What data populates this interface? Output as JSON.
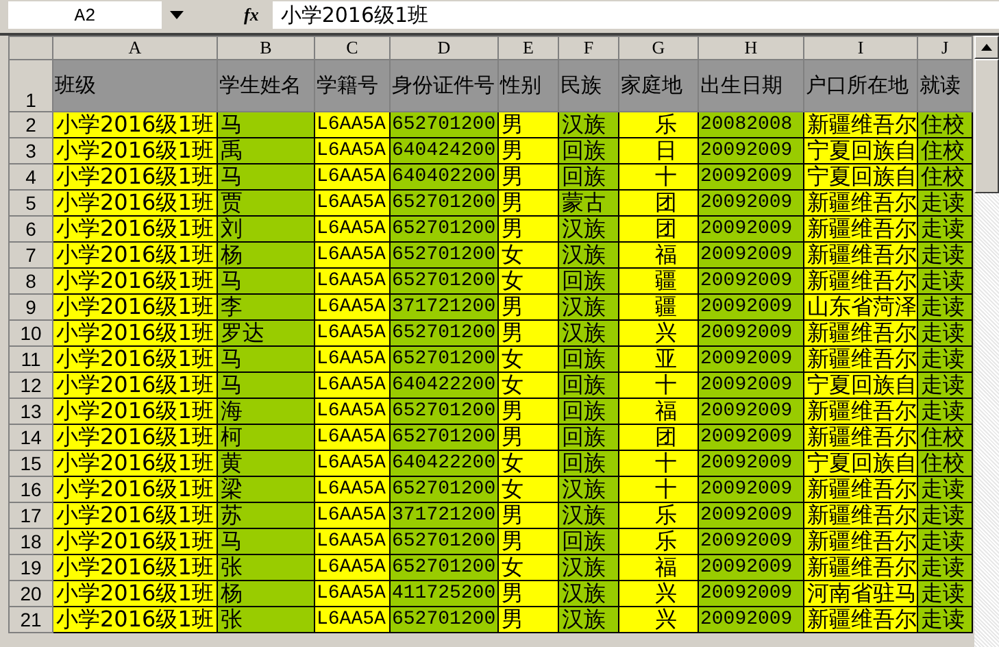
{
  "name_box": "A2",
  "formula": {
    "icon": "fx",
    "value": "小学2016级1班"
  },
  "columns": [
    {
      "letter": "A",
      "color": "#ffff00"
    },
    {
      "letter": "B",
      "color": "#99cc00"
    },
    {
      "letter": "C",
      "color": "#ffff00"
    },
    {
      "letter": "D",
      "color": "#99cc00"
    },
    {
      "letter": "E",
      "color": "#ffff00"
    },
    {
      "letter": "F",
      "color": "#99cc00"
    },
    {
      "letter": "G",
      "color": "#ffff00"
    },
    {
      "letter": "H",
      "color": "#99cc00"
    },
    {
      "letter": "I",
      "color": "#ffff00"
    },
    {
      "letter": "J",
      "color": "#99cc00"
    }
  ],
  "header_row": {
    "number": "1",
    "cells": [
      "班级",
      "学生姓名",
      "学籍号",
      "身份证件号",
      "性别",
      "民族",
      "家庭地",
      "出生日期",
      "户口所在地",
      "就读"
    ]
  },
  "rows": [
    {
      "number": "2",
      "cells": [
        "小学2016级1班",
        "马",
        "L6AA5A",
        "652701200",
        "男",
        "汉族",
        "乐",
        "20082008",
        "新疆维吾尔",
        "住校"
      ]
    },
    {
      "number": "3",
      "cells": [
        "小学2016级1班",
        "禹",
        "L6AA5A",
        "640424200",
        "男",
        "回族",
        "日",
        "20092009",
        "宁夏回族自",
        "住校"
      ]
    },
    {
      "number": "4",
      "cells": [
        "小学2016级1班",
        "马",
        "L6AA5A",
        "640402200",
        "男",
        "回族",
        "十",
        "20092009",
        "宁夏回族自",
        "住校"
      ]
    },
    {
      "number": "5",
      "cells": [
        "小学2016级1班",
        "贾",
        "L6AA5A",
        "652701200",
        "男",
        "蒙古",
        "团",
        "20092009",
        "新疆维吾尔",
        "走读"
      ]
    },
    {
      "number": "6",
      "cells": [
        "小学2016级1班",
        "刘",
        "L6AA5A",
        "652701200",
        "男",
        "汉族",
        "团",
        "20092009",
        "新疆维吾尔",
        "走读"
      ]
    },
    {
      "number": "7",
      "cells": [
        "小学2016级1班",
        "杨",
        "L6AA5A",
        "652701200",
        "女",
        "汉族",
        "福",
        "20092009",
        "新疆维吾尔",
        "走读"
      ]
    },
    {
      "number": "8",
      "cells": [
        "小学2016级1班",
        "马",
        "L6AA5A",
        "652701200",
        "女",
        "回族",
        "疆",
        "20092009",
        "新疆维吾尔",
        "走读"
      ]
    },
    {
      "number": "9",
      "cells": [
        "小学2016级1班",
        "李",
        "L6AA5A",
        "371721200",
        "男",
        "汉族",
        "疆",
        "20092009",
        "山东省菏泽",
        "走读"
      ]
    },
    {
      "number": "10",
      "cells": [
        "小学2016级1班",
        "罗达",
        "L6AA5A",
        "652701200",
        "男",
        "汉族",
        "兴",
        "20092009",
        "新疆维吾尔",
        "走读"
      ]
    },
    {
      "number": "11",
      "cells": [
        "小学2016级1班",
        "马",
        "L6AA5A",
        "652701200",
        "女",
        "回族",
        "亚",
        "20092009",
        "新疆维吾尔",
        "走读"
      ]
    },
    {
      "number": "12",
      "cells": [
        "小学2016级1班",
        "马",
        "L6AA5A",
        "640422200",
        "女",
        "回族",
        "十",
        "20092009",
        "宁夏回族自",
        "走读"
      ]
    },
    {
      "number": "13",
      "cells": [
        "小学2016级1班",
        "海",
        "L6AA5A",
        "652701200",
        "男",
        "回族",
        "福",
        "20092009",
        "新疆维吾尔",
        "走读"
      ]
    },
    {
      "number": "14",
      "cells": [
        "小学2016级1班",
        "柯",
        "L6AA5A",
        "652701200",
        "男",
        "回族",
        "团",
        "20092009",
        "新疆维吾尔",
        "住校"
      ]
    },
    {
      "number": "15",
      "cells": [
        "小学2016级1班",
        "黄",
        "L6AA5A",
        "640422200",
        "女",
        "回族",
        "十",
        "20092009",
        "宁夏回族自",
        "住校"
      ]
    },
    {
      "number": "16",
      "cells": [
        "小学2016级1班",
        "梁",
        "L6AA5A",
        "652701200",
        "女",
        "汉族",
        "十",
        "20092009",
        "新疆维吾尔",
        "走读"
      ]
    },
    {
      "number": "17",
      "cells": [
        "小学2016级1班",
        "苏",
        "L6AA5A",
        "371721200",
        "男",
        "汉族",
        "乐",
        "20092009",
        "新疆维吾尔",
        "走读"
      ]
    },
    {
      "number": "18",
      "cells": [
        "小学2016级1班",
        "马",
        "L6AA5A",
        "652701200",
        "男",
        "回族",
        "乐",
        "20092009",
        "新疆维吾尔",
        "走读"
      ]
    },
    {
      "number": "19",
      "cells": [
        "小学2016级1班",
        "张",
        "L6AA5A",
        "652701200",
        "女",
        "汉族",
        "福",
        "20092009",
        "新疆维吾尔",
        "走读"
      ]
    },
    {
      "number": "20",
      "cells": [
        "小学2016级1班",
        "杨",
        "L6AA5A",
        "411725200",
        "男",
        "汉族",
        "兴",
        "20092009",
        "河南省驻马",
        "走读"
      ]
    },
    {
      "number": "21",
      "cells": [
        "小学2016级1班",
        "张",
        "L6AA5A",
        "652701200",
        "男",
        "汉族",
        "兴",
        "20092009",
        "新疆维吾尔",
        "走读"
      ]
    }
  ]
}
